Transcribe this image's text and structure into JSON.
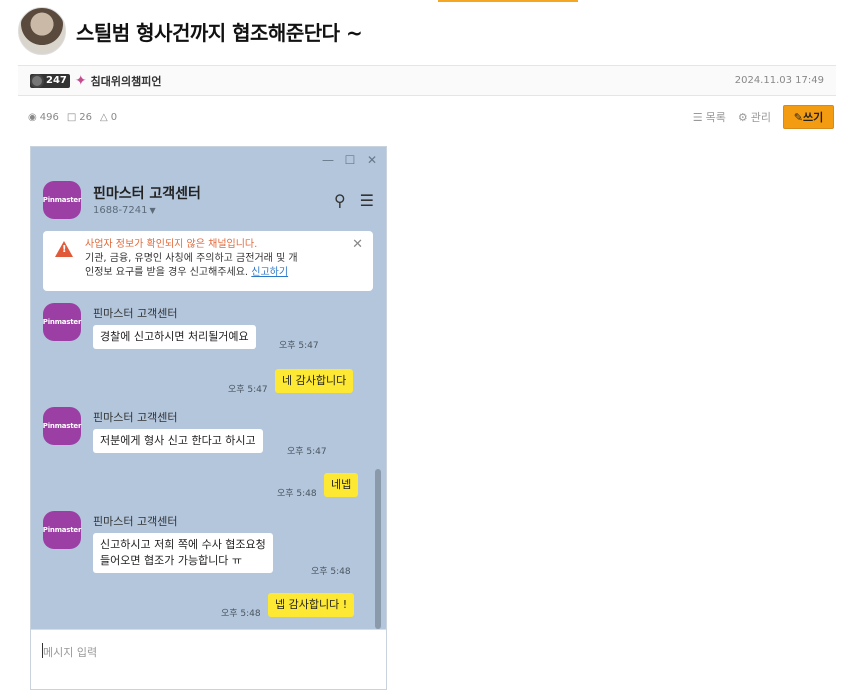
{
  "post": {
    "title": "스틸범 형사건까지 협조해준단다 ~",
    "level": "247",
    "author": "침대위의챔피언",
    "date": "2024.11.03 17:49",
    "views": "496",
    "comments": "26",
    "likes": "0",
    "list_label": "목록",
    "manage_label": "관리",
    "write_label": "쓰기"
  },
  "chat": {
    "logo_text": "Pinmaster",
    "channel_name": "핀마스터 고객센터",
    "phone": "1688-7241",
    "notice_title": "사업자 정보가 확인되지 않은 채널입니다.",
    "notice_line1": "기관, 금융, 유명인 사칭에 주의하고 금전거래 및 개",
    "notice_line2": "인정보 요구를 받을 경우 신고해주세요.",
    "notice_link": "신고하기",
    "sender": "핀마스터 고객센터",
    "messages": [
      {
        "text": "경찰에 신고하시면 처리될거예요",
        "time": "오후 5:47"
      },
      {
        "text": "네 감사합니다",
        "time": "오후 5:47"
      },
      {
        "text": "저분에게 형사 신고 한다고 하시고",
        "time": "오후 5:47"
      },
      {
        "text": "네넵",
        "time": "오후 5:48"
      },
      {
        "text": "신고하시고 저희 쪽에 수사 협조요청",
        "text2": "들어오면 협조가 가능합니다 ㅠ",
        "time": "오후 5:48"
      },
      {
        "text": "넵 감사합니다 !",
        "time": "오후 5:48"
      }
    ],
    "input_placeholder": "메시지 입력"
  }
}
